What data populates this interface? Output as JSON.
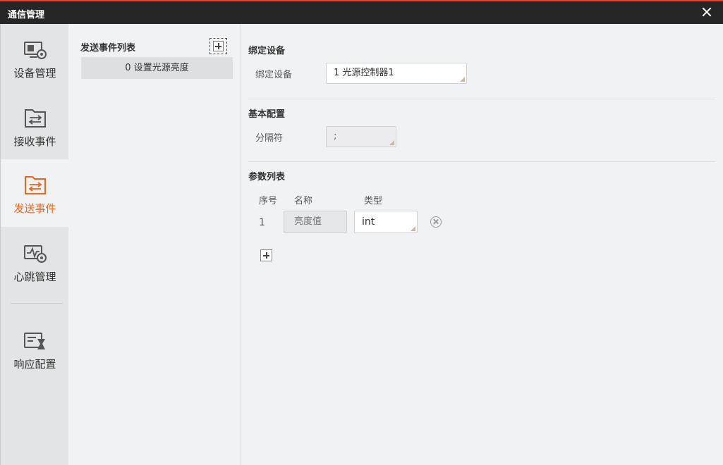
{
  "window": {
    "title": "通信管理"
  },
  "sidebar": {
    "items": [
      {
        "label": "设备管理",
        "icon": "device-settings-icon"
      },
      {
        "label": "接收事件",
        "icon": "receive-event-icon"
      },
      {
        "label": "发送事件",
        "icon": "send-event-icon",
        "active": true
      },
      {
        "label": "心跳管理",
        "icon": "heartbeat-icon"
      },
      {
        "label": "响应配置",
        "icon": "response-config-icon"
      }
    ]
  },
  "event_list": {
    "title": "发送事件列表",
    "items": [
      {
        "label": "0 设置光源亮度"
      }
    ]
  },
  "bind_section": {
    "title": "绑定设备",
    "field_label": "绑定设备",
    "device_value": "1 光源控制器1"
  },
  "basic_section": {
    "title": "基本配置",
    "separator_label": "分隔符",
    "separator_value": ";"
  },
  "params_section": {
    "title": "参数列表",
    "columns": {
      "index": "序号",
      "name": "名称",
      "type": "类型"
    },
    "rows": [
      {
        "index": "1",
        "name": "亮度值",
        "type": "int"
      }
    ]
  },
  "colors": {
    "accent": "#e8661e",
    "titlebar": "#262626",
    "top_border": "#e8402c"
  }
}
